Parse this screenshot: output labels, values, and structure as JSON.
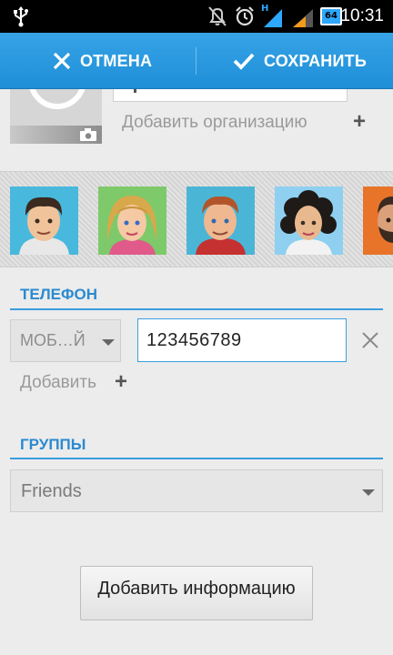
{
  "status_bar": {
    "time": "10:31",
    "network_label": "H",
    "battery_level": "64",
    "icons": [
      "usb-icon",
      "mute-icon",
      "alarm-icon",
      "signal-icon",
      "signal-icon",
      "battery-icon"
    ]
  },
  "action_bar": {
    "cancel_label": "ОТМЕНА",
    "save_label": "СОХРАНИТЬ",
    "color": "#2196e0"
  },
  "organization": {
    "add_label": "Добавить организацию",
    "plus": "+"
  },
  "avatars": [
    "avatar-man-dark-hair",
    "avatar-woman-blonde",
    "avatar-man-red-hair",
    "avatar-woman-curly",
    "avatar-man-beard"
  ],
  "phone_section": {
    "title": "ТЕЛЕФОН",
    "type_value": "МОБ…Й",
    "number_value": "123456789",
    "add_label": "Добавить",
    "plus": "+"
  },
  "groups_section": {
    "title": "ГРУППЫ",
    "value": "Friends"
  },
  "more_button": {
    "label": "Добавить информацию"
  },
  "accent_color": "#3a9ee0"
}
